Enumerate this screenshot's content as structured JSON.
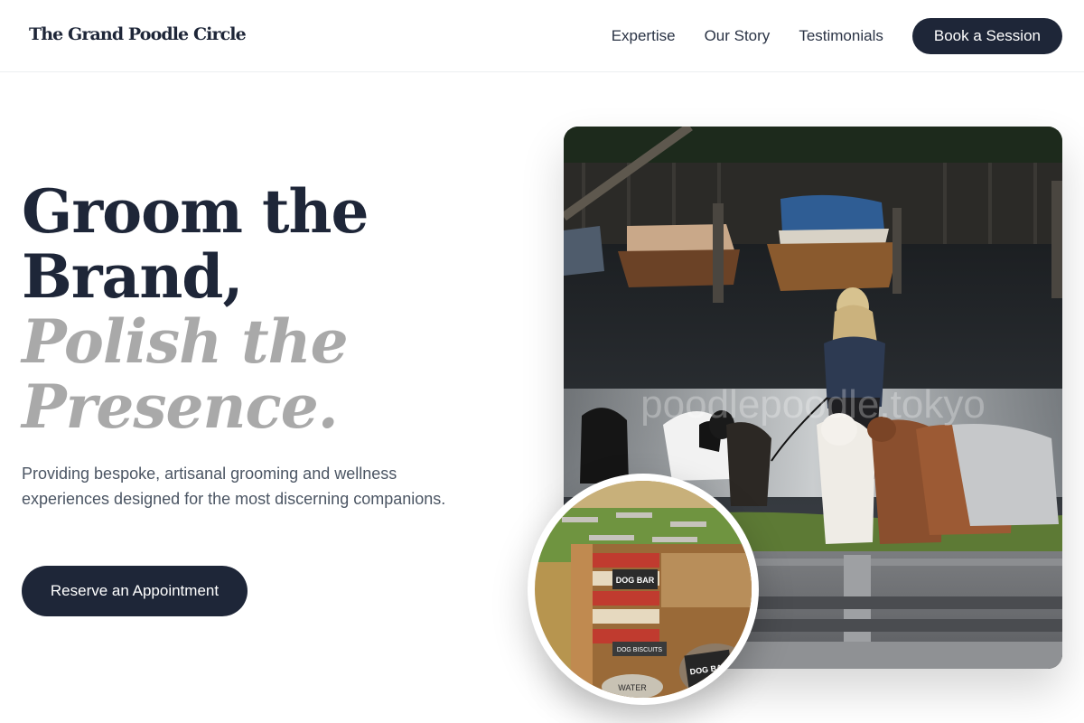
{
  "header": {
    "logo": "The Grand Poodle Circle",
    "nav": [
      {
        "label": "Expertise"
      },
      {
        "label": "Our Story"
      },
      {
        "label": "Testimonials"
      }
    ],
    "cta_label": "Book a Session"
  },
  "hero": {
    "title_lines": [
      "Groom the",
      "Brand,"
    ],
    "title_italic_lines": [
      "Polish the",
      "Presence."
    ],
    "description": "Providing bespoke, artisanal grooming and wellness experiences designed for the most discerning companions.",
    "cta_label": "Reserve an Appointment"
  },
  "images": {
    "main_watermark": "poodlepoodle.tokyo",
    "inset_signs": [
      "DOG BAR",
      "DOG BISCUITS",
      "WATER",
      "DOG BA"
    ]
  },
  "colors": {
    "navy": "#1e2638",
    "muted_title": "#a9a9a9",
    "body_text": "#4b5563"
  }
}
